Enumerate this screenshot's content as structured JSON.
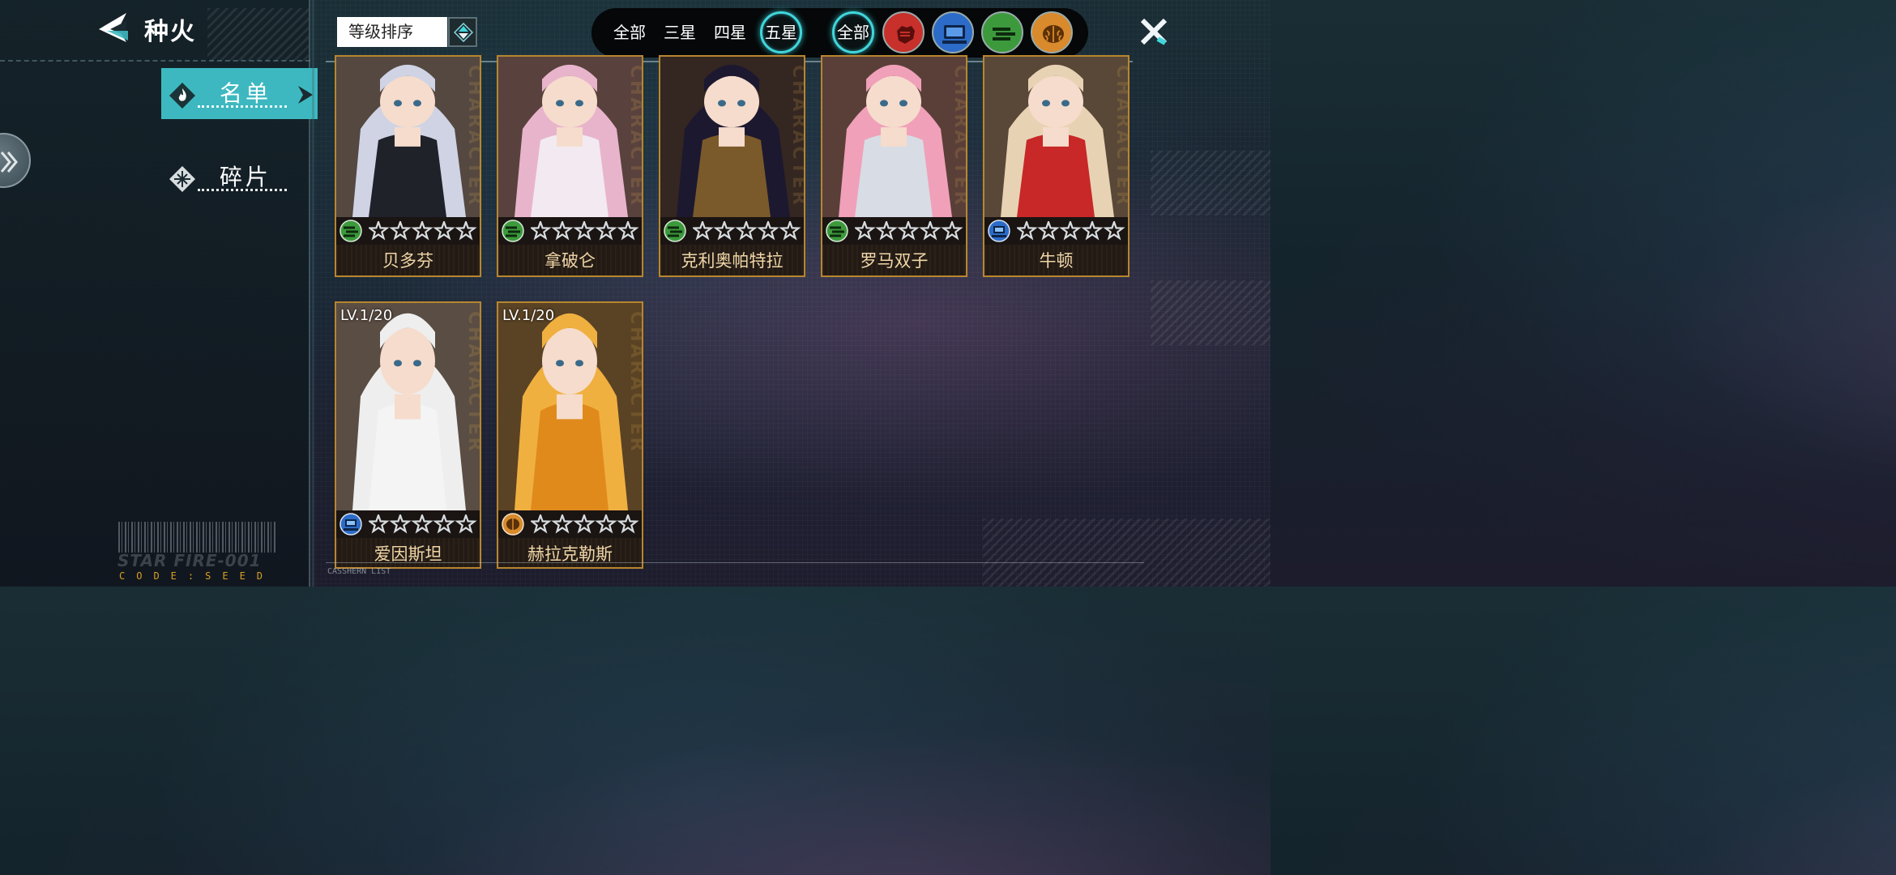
{
  "header": {
    "title": "种火"
  },
  "sidebar": {
    "items": [
      {
        "label": "名单",
        "active": true
      },
      {
        "label": "碎片",
        "active": false
      }
    ],
    "barcode_text": "STAR FIRE-001",
    "code_text": "CODE:SEED"
  },
  "sort": {
    "label": "等级排序"
  },
  "star_filters": [
    {
      "label": "全部",
      "selected": false
    },
    {
      "label": "三星",
      "selected": false
    },
    {
      "label": "四星",
      "selected": false
    },
    {
      "label": "五星",
      "selected": true
    }
  ],
  "class_filters": {
    "all_label": "全部",
    "items": [
      {
        "icon": "fist-icon",
        "color": "#c8302c"
      },
      {
        "icon": "computer-icon",
        "color": "#2c6cc8"
      },
      {
        "icon": "speed-icon",
        "color": "#3c9a3c"
      },
      {
        "icon": "brain-icon",
        "color": "#d88a2c"
      }
    ]
  },
  "cards": [
    {
      "name": "贝多芬",
      "class_icon": "speed-icon",
      "stars": 5,
      "level": "",
      "hair": "#cfd3e4",
      "outfit": "#20222a"
    },
    {
      "name": "拿破仑",
      "class_icon": "speed-icon",
      "stars": 5,
      "level": "",
      "hair": "#e8b4cc",
      "outfit": "#f2eaf0"
    },
    {
      "name": "克利奥帕特拉",
      "class_icon": "speed-icon",
      "stars": 5,
      "level": "",
      "hair": "#1c1830",
      "outfit": "#7a5a2a"
    },
    {
      "name": "罗马双子",
      "class_icon": "speed-icon",
      "stars": 5,
      "level": "",
      "hair": "#f0a0b8",
      "outfit": "#d8dce4"
    },
    {
      "name": "牛顿",
      "class_icon": "computer-icon",
      "stars": 5,
      "level": "",
      "hair": "#e8d2b4",
      "outfit": "#c82828"
    },
    {
      "name": "爱因斯坦",
      "class_icon": "computer-icon",
      "stars": 5,
      "level": "LV.1/20",
      "hair": "#eeeeee",
      "outfit": "#f4f4f4"
    },
    {
      "name": "赫拉克勒斯",
      "class_icon": "brain-icon",
      "stars": 5,
      "level": "LV.1/20",
      "hair": "#f0b040",
      "outfit": "#e08a1c"
    }
  ],
  "watermark": "CHARACTER",
  "footer": {
    "caption": "CASSHERN LIST"
  }
}
